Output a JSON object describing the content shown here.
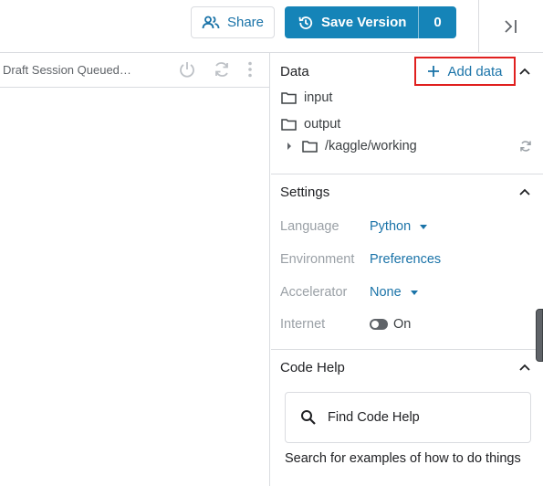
{
  "header": {
    "share_label": "Share",
    "save_label": "Save Version",
    "save_count": "0"
  },
  "session": {
    "status": "Draft Session Queued…"
  },
  "data_section": {
    "title": "Data",
    "add_label": "Add data",
    "items": {
      "input": "input",
      "output": "output",
      "working": "/kaggle/working"
    }
  },
  "settings": {
    "title": "Settings",
    "language": {
      "label": "Language",
      "value": "Python"
    },
    "environment": {
      "label": "Environment",
      "value": "Preferences"
    },
    "accelerator": {
      "label": "Accelerator",
      "value": "None"
    },
    "internet": {
      "label": "Internet",
      "value": "On"
    }
  },
  "code_help": {
    "title": "Code Help",
    "search_label": "Find Code Help",
    "description": "Search for examples of how to do things"
  },
  "colors": {
    "accent": "#1584b8",
    "link": "#1a73a8",
    "highlight": "#e0201f"
  }
}
